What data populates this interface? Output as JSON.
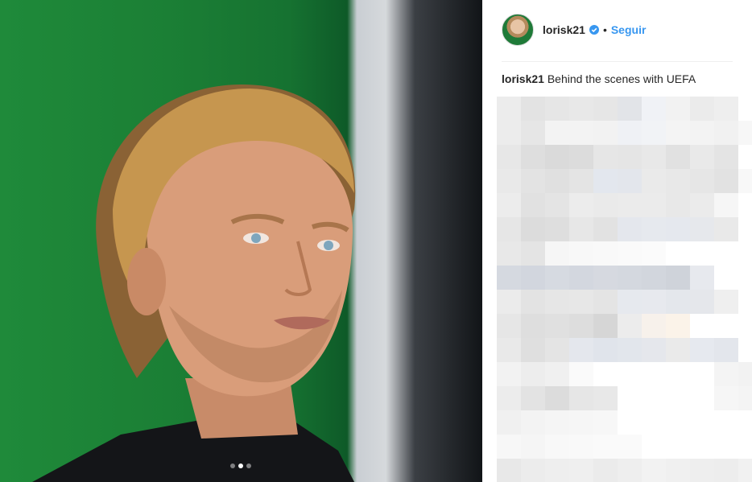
{
  "post": {
    "username": "lorisk21",
    "verified_icon": "verified-badge-icon",
    "separator": "•",
    "follow_label": "Seguir",
    "caption_user": "lorisk21",
    "caption_text": "Behind the scenes with UEFA"
  },
  "carousel": {
    "total": 3,
    "active_index": 1
  },
  "colors": {
    "follow_blue": "#3897f0",
    "verified_blue": "#3897f0",
    "text": "#262626"
  }
}
